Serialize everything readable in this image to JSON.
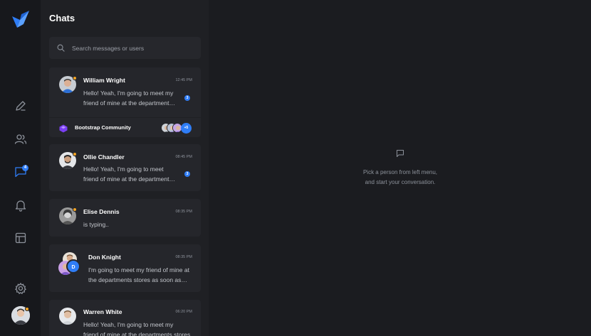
{
  "nav": {
    "logo": "bird-logo",
    "items": [
      {
        "icon": "pencil-icon"
      },
      {
        "icon": "users-icon"
      },
      {
        "icon": "chat-icon",
        "badge": "4"
      },
      {
        "icon": "bell-icon"
      },
      {
        "icon": "layout-icon"
      },
      {
        "icon": "gear-icon"
      }
    ],
    "accent_color": "#2f7df6",
    "status_color": "#f5a524"
  },
  "chats": {
    "title": "Chats",
    "search_placeholder": "Search messages or users",
    "items": [
      {
        "name": "William Wright",
        "time": "12:45 PM",
        "message_line1": "Hello! Yeah, I'm going to meet my",
        "message_line2": "friend of mine at the department…",
        "unread": "3"
      },
      {
        "name": "Ollie Chandler",
        "time": "08:45 PM",
        "message_line1": "Hello! Yeah, I'm going to meet",
        "message_line2": "friend of mine at the department…",
        "unread": "3"
      },
      {
        "name": "Elise Dennis",
        "time": "08:35 PM",
        "message_line1": "is typing.."
      },
      {
        "name": "Don Knight",
        "time": "08:35 PM",
        "message_line1": "I'm going to meet my friend of mine at",
        "message_line2": "the departments stores as soon as…",
        "initial": "D"
      },
      {
        "name": "Warren White",
        "time": "06:20 PM",
        "message_line1": "Hello! Yeah, I'm going to meet my",
        "message_line2": "friend of mine at the departments stores as…"
      }
    ],
    "group": {
      "name": "Bootstrap Community",
      "more": "+5"
    }
  },
  "empty_state": {
    "line1": "Pick a person from left menu,",
    "line2": "and start your conversation."
  }
}
